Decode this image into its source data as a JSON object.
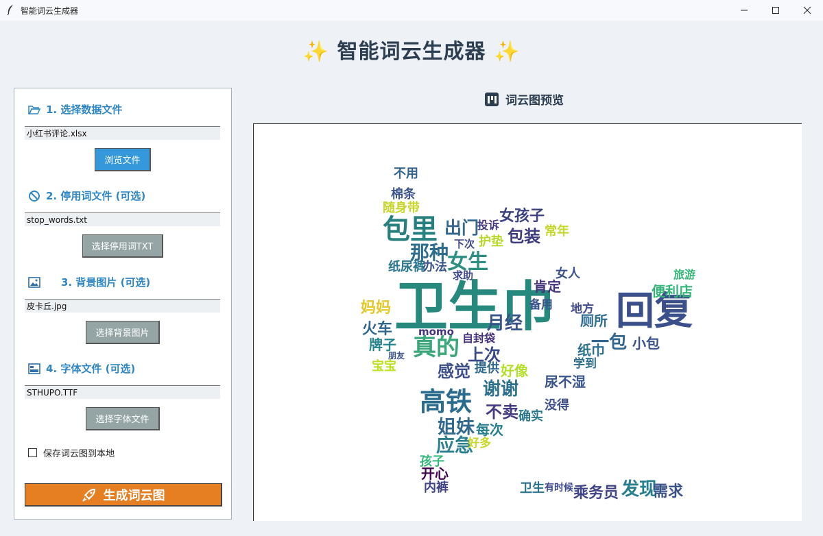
{
  "window": {
    "title": "智能词云生成器"
  },
  "header": {
    "title": "智能词云生成器"
  },
  "sections": [
    {
      "label": "1. 选择数据文件",
      "value": "小红书评论.xlsx",
      "button": "浏览文件"
    },
    {
      "label": "2. 停用词文件 (可选)",
      "value": "stop_words.txt",
      "button": "选择停用词TXT"
    },
    {
      "label": "3. 背景图片 (可选)",
      "value": "皮卡丘.jpg",
      "button": "选择背景图片"
    },
    {
      "label": "4. 字体文件 (可选)",
      "value": "STHUPO.TTF",
      "button": "选择字体文件"
    }
  ],
  "save_option": {
    "label": "保存词云图到本地",
    "checked": false
  },
  "generate_button": "生成词云图",
  "preview": {
    "title": "词云图预览"
  },
  "colors": {
    "accent_blue": "#3498db",
    "gray_button": "#95a5a6",
    "orange": "#e67e22",
    "section_title": "#2f86c4",
    "heading": "#2c3e50"
  },
  "cloud_words": [
    {
      "text": "卫生巾",
      "color": "#27897e"
    },
    {
      "text": "回复",
      "color": "#3b4f8a"
    },
    {
      "text": "包里",
      "color": "#28807e"
    },
    {
      "text": "高铁",
      "color": "#2b6c8e"
    },
    {
      "text": "真的",
      "color": "#3aa77a"
    },
    {
      "text": "女生",
      "color": "#2c8f81"
    },
    {
      "text": "那种",
      "color": "#2f6d8e"
    },
    {
      "text": "月经",
      "color": "#3b538b"
    },
    {
      "text": "姐妹",
      "color": "#316a8e"
    },
    {
      "text": "应急",
      "color": "#2c7f8e"
    },
    {
      "text": "谢谢",
      "color": "#2d718e"
    },
    {
      "text": "感觉",
      "color": "#3c4d89"
    },
    {
      "text": "出门",
      "color": "#35678d"
    },
    {
      "text": "包装",
      "color": "#3e3c7f"
    },
    {
      "text": "女孩子",
      "color": "#3e437f"
    },
    {
      "text": "发现",
      "color": "#277e8e"
    },
    {
      "text": "需求",
      "color": "#3b5289"
    },
    {
      "text": "乘务员",
      "color": "#414487"
    },
    {
      "text": "一包",
      "color": "#31668e"
    },
    {
      "text": "纸巾",
      "color": "#2c728e"
    },
    {
      "text": "上次",
      "color": "#3a4a86"
    },
    {
      "text": "火车",
      "color": "#31678e"
    },
    {
      "text": "牌子",
      "color": "#25858e"
    },
    {
      "text": "不卖",
      "color": "#443b84"
    },
    {
      "text": "开心",
      "color": "#440154"
    },
    {
      "text": "内裤",
      "color": "#404387"
    },
    {
      "text": "妈妈",
      "color": "#e2c82a"
    },
    {
      "text": "常年",
      "color": "#c4d72a"
    },
    {
      "text": "护垫",
      "color": "#b7d82a"
    },
    {
      "text": "肯定",
      "color": "#46337e"
    },
    {
      "text": "厕所",
      "color": "#2f6b8e"
    },
    {
      "text": "小包",
      "color": "#3a528b"
    },
    {
      "text": "便利店",
      "color": "#35b779"
    },
    {
      "text": "旅游",
      "color": "#35b779"
    },
    {
      "text": "不用",
      "color": "#32658e"
    },
    {
      "text": "棉条",
      "color": "#3b548b"
    },
    {
      "text": "随身带",
      "color": "#c8d62a"
    },
    {
      "text": "纸尿裤",
      "color": "#2a768e"
    },
    {
      "text": "办法",
      "color": "#3a548c"
    },
    {
      "text": "女人",
      "color": "#3b528b"
    },
    {
      "text": "宝宝",
      "color": "#bddf26"
    },
    {
      "text": "好像",
      "color": "#b5de2b"
    },
    {
      "text": "提供",
      "color": "#31688e"
    },
    {
      "text": "自封袋",
      "color": "#46317e"
    },
    {
      "text": "每次",
      "color": "#277f8e"
    },
    {
      "text": "孩子",
      "color": "#35b779"
    },
    {
      "text": "确实",
      "color": "#2a788e"
    },
    {
      "text": "没得",
      "color": "#3d4e8a"
    },
    {
      "text": "尿不湿",
      "color": "#3a548c"
    },
    {
      "text": "地方",
      "color": "#3f4889"
    },
    {
      "text": "学到",
      "color": "#2e6e8e"
    },
    {
      "text": "卫生",
      "color": "#2c728e"
    },
    {
      "text": "有时候",
      "color": "#3e4989"
    },
    {
      "text": "momo",
      "color": "#46327e"
    },
    {
      "text": "投诉",
      "color": "#443a83"
    },
    {
      "text": "下次",
      "color": "#3e4989"
    },
    {
      "text": "备用",
      "color": "#3b538b"
    },
    {
      "text": "求助",
      "color": "#3e4989"
    },
    {
      "text": "好多",
      "color": "#c9d62a"
    },
    {
      "text": "朋友",
      "color": "#3b528b"
    }
  ]
}
